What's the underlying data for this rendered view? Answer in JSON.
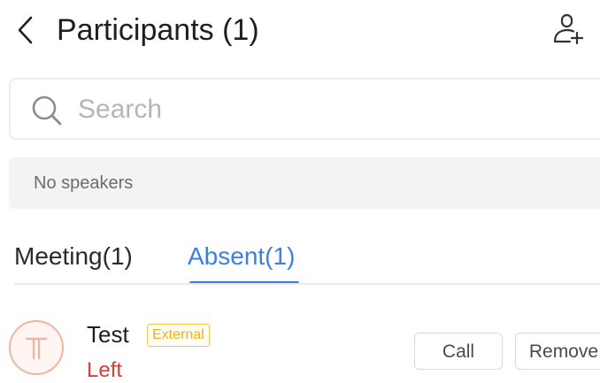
{
  "header": {
    "title": "Participants (1)",
    "back_icon": "chevron-left-icon",
    "add_icon": "add-user-icon"
  },
  "search": {
    "placeholder": "Search",
    "value": ""
  },
  "speakers": {
    "text": "No speakers"
  },
  "tabs": [
    {
      "label": "Meeting(1)",
      "active": false
    },
    {
      "label": "Absent(1)",
      "active": true
    }
  ],
  "participants": [
    {
      "name": "Test",
      "badge": "External",
      "status": "Left",
      "avatar_letter": "T",
      "actions": {
        "call": "Call",
        "remove": "Remove"
      }
    }
  ],
  "colors": {
    "accent": "#3a7fe8",
    "status_left": "#e23a32",
    "badge": "#f0b020",
    "avatar_ring": "#f2b3a2"
  }
}
